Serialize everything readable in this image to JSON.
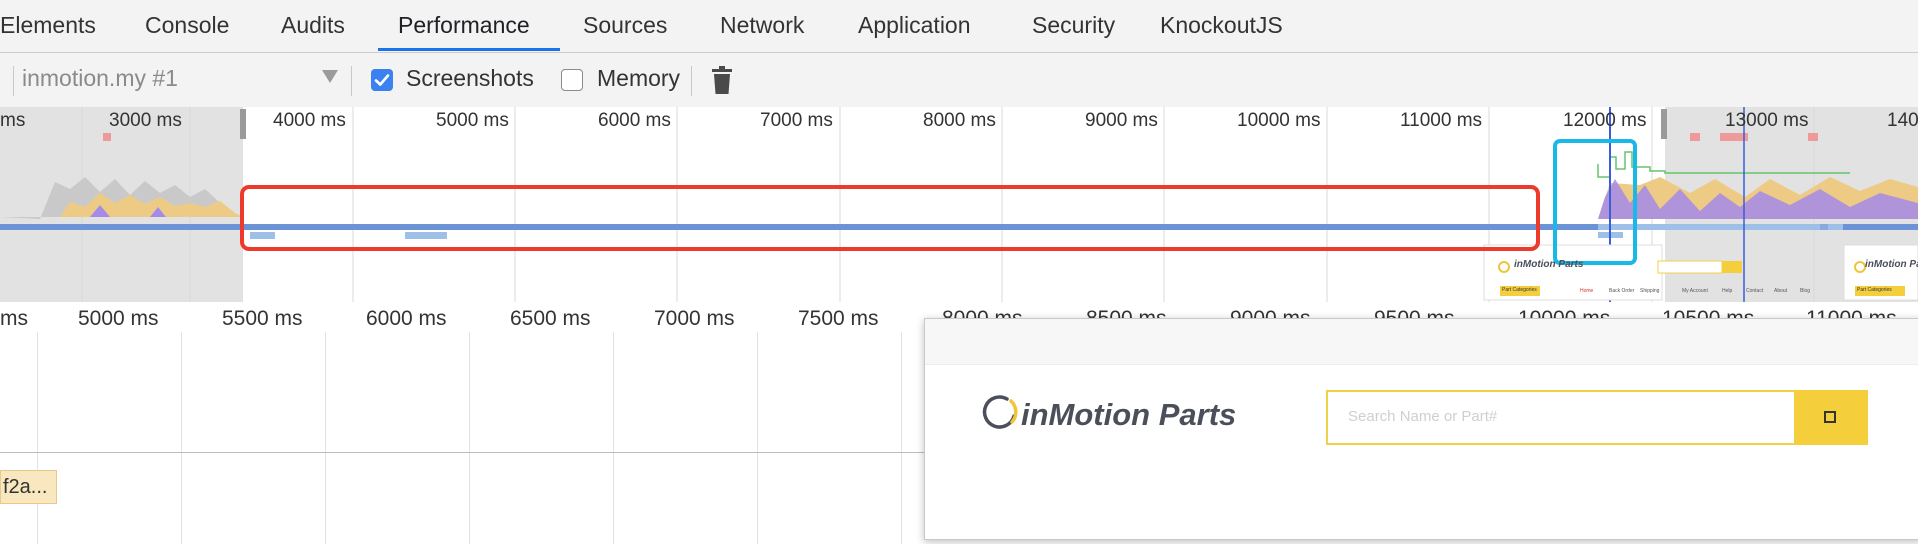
{
  "tabs": [
    {
      "label": "Elements"
    },
    {
      "label": "Console"
    },
    {
      "label": "Audits"
    },
    {
      "label": "Performance"
    },
    {
      "label": "Sources"
    },
    {
      "label": "Network"
    },
    {
      "label": "Application"
    },
    {
      "label": "Security"
    },
    {
      "label": "KnockoutJS"
    }
  ],
  "active_tab": "Performance",
  "toolbar": {
    "recording_select": "inmotion.my #1",
    "screenshots_label": "Screenshots",
    "screenshots_checked": true,
    "memory_label": "Memory",
    "memory_checked": false,
    "trash_icon": "trash-icon"
  },
  "overview": {
    "ticks": [
      "ms",
      "3000 ms",
      "4000 ms",
      "5000 ms",
      "6000 ms",
      "7000 ms",
      "8000 ms",
      "9000 ms",
      "10000 ms",
      "11000 ms",
      "12000 ms",
      "13000 ms",
      "140"
    ]
  },
  "timeline": {
    "ticks": [
      "ms",
      "5000 ms",
      "5500 ms",
      "6000 ms",
      "6500 ms",
      "7000 ms",
      "7500 ms",
      "8000 ms",
      "8500 ms",
      "9000 ms",
      "9500 ms",
      "10000 ms",
      "10500 ms",
      "11000 ms"
    ],
    "chip_text": "f2a..."
  },
  "thumbnail": {
    "logo_text": "inMotion Parts",
    "menu_items": [
      "Part Categories",
      "Home",
      "Back Order",
      "Shipping",
      "My Account",
      "Help",
      "Contact",
      "About",
      "Blog"
    ]
  },
  "screenshot_popup": {
    "logo_text": "inMotion Parts",
    "search_placeholder": "Search Name or Part#",
    "search_icon": "search-square-icon"
  },
  "colors": {
    "annotation_red": "#ee3a2d",
    "annotation_cyan": "#1ab8e8",
    "accent_blue": "#1a73e8",
    "logo_yellow": "#f5cf3b"
  }
}
